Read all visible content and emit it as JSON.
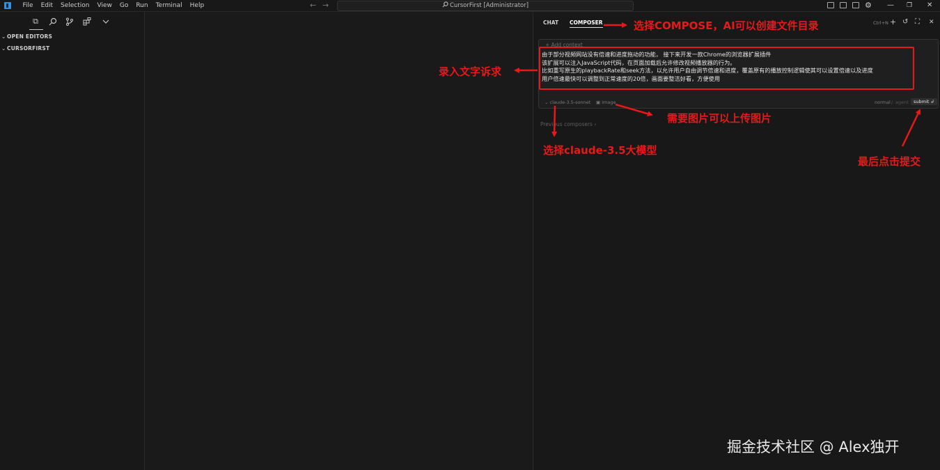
{
  "titlebar": {
    "menu": [
      "File",
      "Edit",
      "Selection",
      "View",
      "Go",
      "Run",
      "Terminal",
      "Help"
    ],
    "search_title": "CursorFirst [Administrator]",
    "back_arrow": "←",
    "forward_arrow": "→"
  },
  "sidebar": {
    "sections": [
      "OPEN EDITORS",
      "CURSORFIRST"
    ]
  },
  "panel": {
    "tabs": [
      "CHAT",
      "COMPOSER"
    ],
    "shortcut": "Ctrl+N",
    "add_context": "+ Add context",
    "prompt_lines": [
      "由于部分视频网站没有倍速和进度拖动的功能， 接下来开发一款Chrome的浏览器扩展插件",
      "该扩展可以注入JavaScript代码，在页面加载后允许修改视频播放器的行为。",
      "比如重写原生的playbackRate和seek方法，以允许用户自由调节倍速和进度，覆盖原有的播放控制逻辑使其可以设置倍速以及进度",
      "用户倍速最快可以调整到正常速度的20倍，画面要整洁好看，方便使用"
    ],
    "model_label": "claude-3.5-sonnet",
    "image_label": "image",
    "mode_normal": "normal",
    "mode_agent": "agent",
    "submit_label": "submit",
    "previous_composers": "Previous composers"
  },
  "annotations": {
    "compose": "选择COMPOSE，AI可以创建文件目录",
    "input": "录入文字诉求",
    "image": "需要图片可以上传图片",
    "model": "选择claude-3.5大模型",
    "submit": "最后点击提交"
  },
  "colors": {
    "annotation_red": "#e8191a",
    "background": "#181818"
  },
  "watermark": "掘金技术社区 @ Alex独开"
}
